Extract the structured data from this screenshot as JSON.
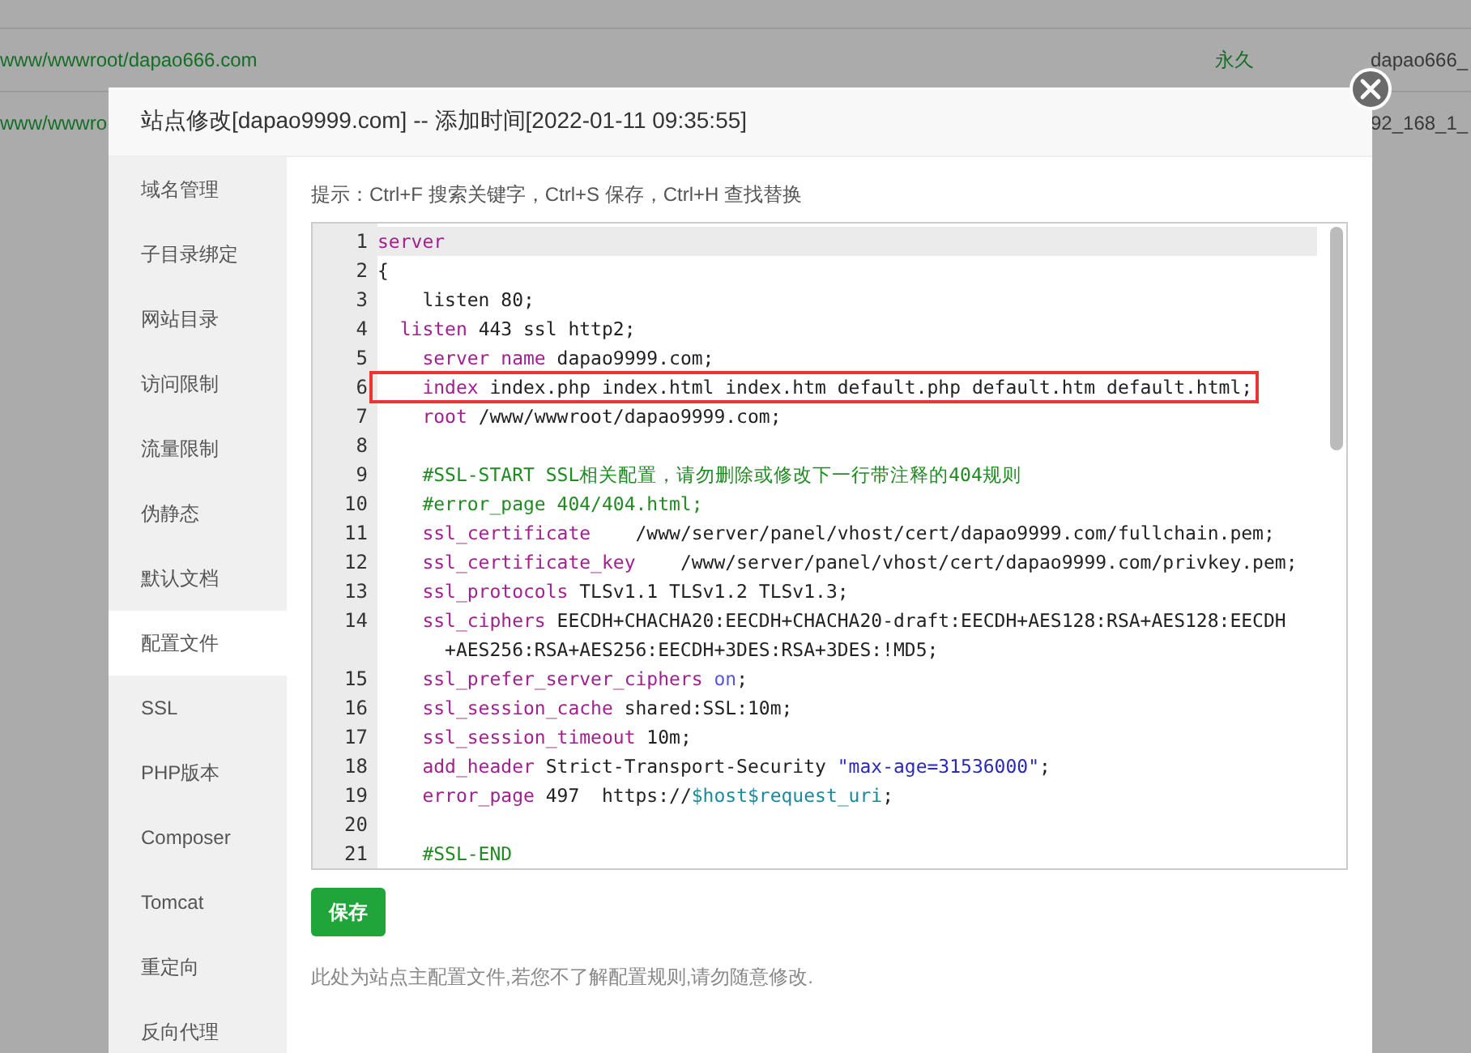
{
  "background_table": {
    "rows": [
      {
        "path": "www/wwwroot/dapao666.com",
        "expiry": "永久",
        "column_3": "dapao666_"
      },
      {
        "path": "www/wwwro",
        "column_3": "92_168_1_"
      }
    ]
  },
  "dialog": {
    "title": "站点修改[dapao9999.com] -- 添加时间[2022-01-11 09:35:55]",
    "sidebar": {
      "items": [
        {
          "label": "域名管理",
          "selected": false
        },
        {
          "label": "子目录绑定",
          "selected": false
        },
        {
          "label": "网站目录",
          "selected": false
        },
        {
          "label": "访问限制",
          "selected": false
        },
        {
          "label": "流量限制",
          "selected": false
        },
        {
          "label": "伪静态",
          "selected": false
        },
        {
          "label": "默认文档",
          "selected": false
        },
        {
          "label": "配置文件",
          "selected": true
        },
        {
          "label": "SSL",
          "selected": false
        },
        {
          "label": "PHP版本",
          "selected": false
        },
        {
          "label": "Composer",
          "selected": false
        },
        {
          "label": "Tomcat",
          "selected": false
        },
        {
          "label": "重定向",
          "selected": false
        },
        {
          "label": "反向代理",
          "selected": false
        }
      ]
    },
    "hint": "提示：Ctrl+F 搜索关键字，Ctrl+S 保存，Ctrl+H 查找替换",
    "editor": {
      "lines": [
        {
          "number": "1",
          "active": true,
          "highlighted": false,
          "segments": [
            {
              "kind": "keyword",
              "text": "server"
            }
          ]
        },
        {
          "number": "2",
          "active": false,
          "highlighted": false,
          "segments": [
            {
              "kind": "plain",
              "text": "{"
            }
          ]
        },
        {
          "number": "3",
          "active": false,
          "highlighted": false,
          "segments": [
            {
              "kind": "plain",
              "text": "    listen 80;"
            }
          ]
        },
        {
          "number": "4",
          "active": false,
          "highlighted": false,
          "segments": [
            {
              "kind": "keyword",
              "text": "  listen"
            },
            {
              "kind": "plain",
              "text": " 443 ssl http2;"
            }
          ]
        },
        {
          "number": "5",
          "active": false,
          "highlighted": false,
          "segments": [
            {
              "kind": "keyword",
              "text": "    server name"
            },
            {
              "kind": "plain",
              "text": " dapao9999.com;"
            }
          ]
        },
        {
          "number": "6",
          "active": false,
          "highlighted": true,
          "segments": [
            {
              "kind": "keyword",
              "text": "    index"
            },
            {
              "kind": "plain",
              "text": " index.php index.html index.htm default.php default.htm default.html;"
            }
          ]
        },
        {
          "number": "7",
          "active": false,
          "highlighted": false,
          "segments": [
            {
              "kind": "keyword",
              "text": "    root"
            },
            {
              "kind": "plain",
              "text": " /www/wwwroot/dapao9999.com;"
            }
          ]
        },
        {
          "number": "8",
          "active": false,
          "highlighted": false
        },
        {
          "number": "9",
          "active": false,
          "highlighted": false,
          "segments": [
            {
              "kind": "comment",
              "text": "    #SSL-START SSL相关配置，请勿删除或修改下一行带注释的404规则"
            }
          ]
        },
        {
          "number": "10",
          "active": false,
          "highlighted": false,
          "segments": [
            {
              "kind": "comment",
              "text": "    #error_page 404/404.html;"
            }
          ]
        },
        {
          "number": "11",
          "active": false,
          "highlighted": false,
          "segments": [
            {
              "kind": "keyword",
              "text": "    ssl_certificate"
            },
            {
              "kind": "plain",
              "text": "    /www/server/panel/vhost/cert/dapao9999.com/fullchain.pem;"
            }
          ]
        },
        {
          "number": "12",
          "active": false,
          "highlighted": false,
          "segments": [
            {
              "kind": "keyword",
              "text": "    ssl_certificate_key"
            },
            {
              "kind": "plain",
              "text": "    /www/server/panel/vhost/cert/dapao9999.com/privkey.pem;"
            }
          ]
        },
        {
          "number": "13",
          "active": false,
          "highlighted": false,
          "segments": [
            {
              "kind": "keyword",
              "text": "    ssl_protocols"
            },
            {
              "kind": "plain",
              "text": " TLSv1.1 TLSv1.2 TLSv1.3;"
            }
          ]
        },
        {
          "number": "14",
          "active": false,
          "highlighted": false,
          "segments": [
            {
              "kind": "keyword",
              "text": "    ssl_ciphers"
            },
            {
              "kind": "plain",
              "text": " EECDH+CHACHA20:EECDH+CHACHA20-draft:EECDH+AES128:RSA+AES128:EECDH"
            }
          ],
          "wrap": [
            {
              "kind": "plain",
              "text": "      +AES256:RSA+AES256:EECDH+3DES:RSA+3DES:!MD5;"
            }
          ]
        },
        {
          "number": "15",
          "active": false,
          "highlighted": false,
          "segments": [
            {
              "kind": "keyword",
              "text": "    ssl_prefer_server_ciphers"
            },
            {
              "kind": "atom",
              "text": " on"
            },
            {
              "kind": "plain",
              "text": ";"
            }
          ]
        },
        {
          "number": "16",
          "active": false,
          "highlighted": false,
          "segments": [
            {
              "kind": "keyword",
              "text": "    ssl_session_cache"
            },
            {
              "kind": "plain",
              "text": " shared:SSL:10m;"
            }
          ]
        },
        {
          "number": "17",
          "active": false,
          "highlighted": false,
          "segments": [
            {
              "kind": "keyword",
              "text": "    ssl_session_timeout"
            },
            {
              "kind": "plain",
              "text": " 10m;"
            }
          ]
        },
        {
          "number": "18",
          "active": false,
          "highlighted": false,
          "segments": [
            {
              "kind": "keyword",
              "text": "    add_header"
            },
            {
              "kind": "plain",
              "text": " Strict-Transport-Security "
            },
            {
              "kind": "string",
              "text": "\"max-age=31536000\""
            },
            {
              "kind": "plain",
              "text": ";"
            }
          ]
        },
        {
          "number": "19",
          "active": false,
          "highlighted": false,
          "segments": [
            {
              "kind": "keyword",
              "text": "    error_page"
            },
            {
              "kind": "plain",
              "text": " 497  https://"
            },
            {
              "kind": "variable",
              "text": "$host$request_uri"
            },
            {
              "kind": "plain",
              "text": ";"
            }
          ]
        },
        {
          "number": "20",
          "active": false,
          "highlighted": false
        },
        {
          "number": "21",
          "active": false,
          "highlighted": false,
          "segments": [
            {
              "kind": "comment",
              "text": "    #SSL-END"
            }
          ]
        }
      ]
    },
    "save_button": "保存",
    "note": "此处为站点主配置文件,若您不了解配置规则,请勿随意修改."
  }
}
